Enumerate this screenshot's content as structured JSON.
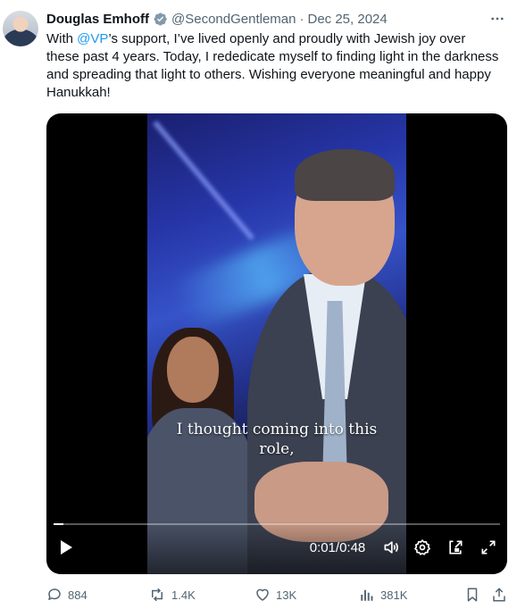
{
  "tweet": {
    "author_name": "Douglas Emhoff",
    "handle": "@SecondGentleman",
    "separator": "·",
    "date": "Dec 25, 2024",
    "text_before": "With ",
    "mention": "@VP",
    "text_after": "’s support, I’ve lived openly and proudly with Jewish joy over these past 4 years. Today, I rededicate myself to finding light in the darkness and spreading that light to others. Wishing everyone meaningful and happy Hanukkah!",
    "accent_color": "#1d9bf0"
  },
  "video": {
    "caption_line1": "I thought coming into this",
    "caption_line2": "role,",
    "current_time": "0:01",
    "time_separator": " / ",
    "duration": "0:48",
    "progress_fraction": 0.021
  },
  "actions": {
    "replies": "884",
    "reposts": "1.4K",
    "likes": "13K",
    "views": "381K"
  },
  "icons": [
    "verified-badge-icon",
    "more-options-icon",
    "play-icon",
    "volume-icon",
    "settings-icon",
    "picture-in-picture-icon",
    "fullscreen-icon",
    "reply-icon",
    "repost-icon",
    "like-icon",
    "views-icon",
    "bookmark-icon",
    "share-icon"
  ]
}
